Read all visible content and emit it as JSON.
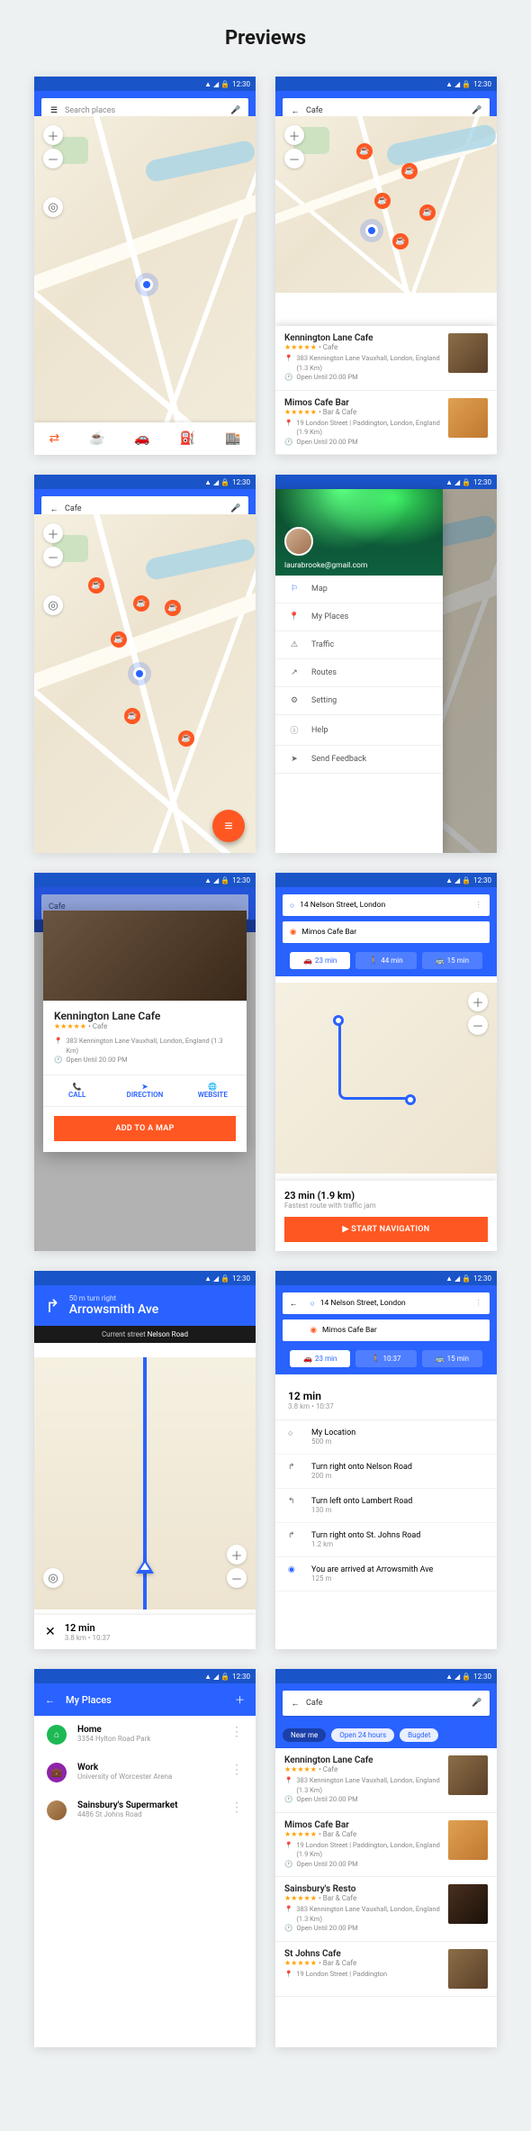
{
  "page_title": "Previews",
  "status": {
    "time": "12:30"
  },
  "search": {
    "placeholder": "Search places",
    "query": "Cafe"
  },
  "map_controls": {
    "plus": "＋",
    "minus": "－",
    "locate": "◎"
  },
  "bottom_icons": [
    "⇄",
    "☕",
    "🚗",
    "⛽",
    "🏬"
  ],
  "place1": {
    "name": "Kennington Lane Cafe",
    "rating": "★★★★★",
    "type": "• Cafe",
    "addr": "383 Kennington Lane Vauxhall, London, England (1.3 Km)",
    "hours": "Open Until 20.00 PM"
  },
  "place2": {
    "name": "Mimos Cafe Bar",
    "rating": "★★★★★",
    "type": "• Bar & Cafe",
    "addr": "19 London Street | Paddington, London, England (1.9 Km)",
    "hours": "Open Until 20.00 PM"
  },
  "place3": {
    "name": "Sainsbury's Resto",
    "rating": "★★★★★",
    "type": "• Bar & Cafe",
    "addr": "383 Kennington Lane Vauxhall, London, England (1.3 Km)",
    "hours": "Open Until 20.00 PM"
  },
  "place4": {
    "name": "St Johns Cafe",
    "rating": "★★★★★",
    "type": "• Bar & Cafe",
    "addr": "19 London Street | Paddington"
  },
  "drawer": {
    "email": "laurabrooke@gmail.com",
    "items": [
      {
        "icon": "⚐",
        "label": "Map"
      },
      {
        "icon": "📍",
        "label": "My Places"
      },
      {
        "icon": "⚠",
        "label": "Traffic"
      },
      {
        "icon": "↗",
        "label": "Routes"
      },
      {
        "icon": "⚙",
        "label": "Setting"
      },
      {
        "icon": "ⓘ",
        "label": "Help"
      },
      {
        "icon": "➤",
        "label": "Send Feedback"
      }
    ]
  },
  "detail": {
    "actions": {
      "call": "CALL",
      "direction": "DIRECTION",
      "website": "WEBSITE"
    },
    "cta": "ADD TO A MAP"
  },
  "route": {
    "from": "14 Nelson Street, London",
    "to": "Mimos Cafe Bar",
    "modes": [
      {
        "icon": "🚗",
        "label": "23 min"
      },
      {
        "icon": "🚶",
        "label": "44 min"
      },
      {
        "icon": "🚌",
        "label": "15 min"
      }
    ],
    "summary_time": "23 min (1.9 km)",
    "summary_sub": "Fastest route with traffic jam",
    "start": "START NAVIGATION"
  },
  "nav": {
    "pre": "50 m turn right",
    "street": "Arrowsmith Ave",
    "current_label": "Current street",
    "current_value": "Nelson Road",
    "bottom_time": "12 min",
    "bottom_sub": "3.8 km • 10:37",
    "close": "✕"
  },
  "steps": {
    "head_time": "12 min",
    "head_sub": "3.8 km • 10:37",
    "modes_walk": "10:37",
    "list": [
      {
        "icon": "○",
        "title": "My Location",
        "dist": "500 m"
      },
      {
        "icon": "↱",
        "title": "Turn right onto Nelson Road",
        "dist": "200 m"
      },
      {
        "icon": "↰",
        "title": "Turn left onto Lambert Road",
        "dist": "130 m"
      },
      {
        "icon": "↱",
        "title": "Turn right onto St. Johns Road",
        "dist": "1.2 km"
      },
      {
        "icon": "◉",
        "title": "You are arrived at Arrowsmith Ave",
        "dist": "125 m"
      }
    ]
  },
  "myplaces": {
    "title": "My Places",
    "items": [
      {
        "name": "Home",
        "sub": "3354 Hylton Road Park"
      },
      {
        "name": "Work",
        "sub": "University of Worcester Arena"
      },
      {
        "name": "Sainsbury's Supermarket",
        "sub": "4486 St Johns Road"
      }
    ]
  },
  "filter": {
    "chips": [
      "Near me",
      "Open 24 hours",
      "Bugdet"
    ]
  }
}
